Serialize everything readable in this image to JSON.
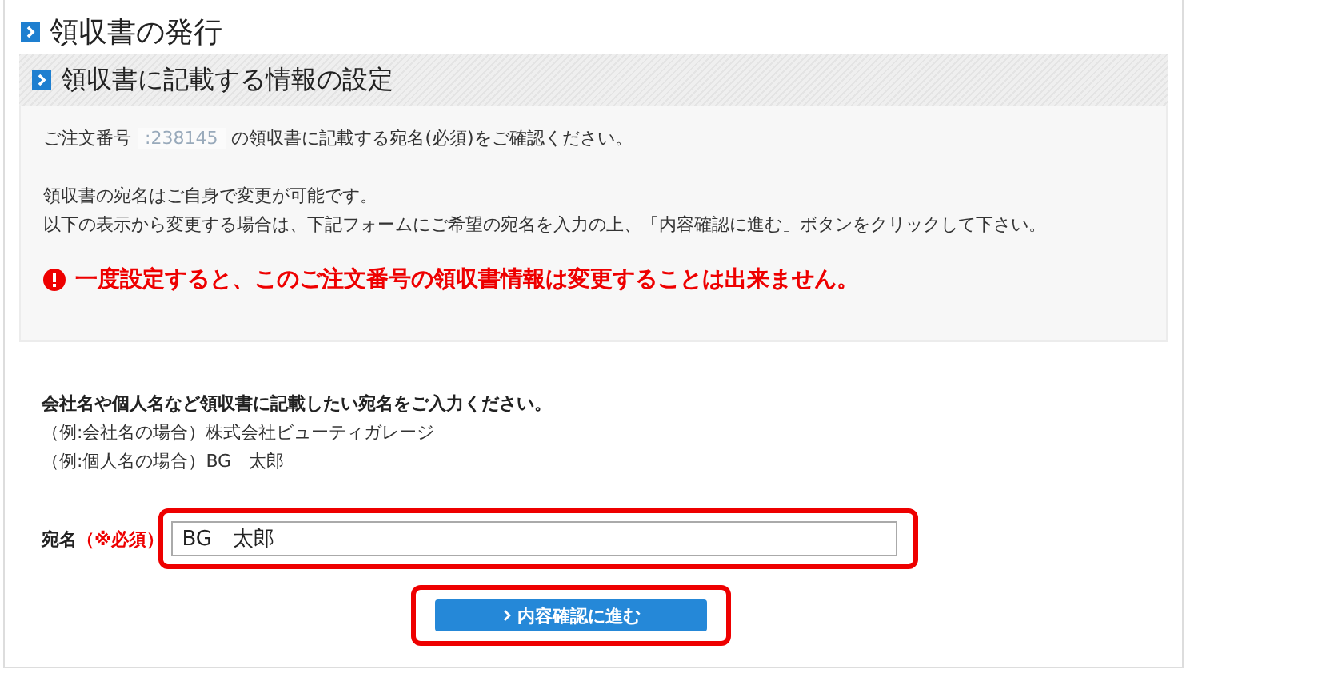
{
  "page_title": "領収書の発行",
  "section": {
    "title": "領収書に記載する情報の設定",
    "order_line": {
      "before": "ご注文番号",
      "order_number": ":238145",
      "after": "の領収書に記載する宛名(必須)をご確認ください。"
    },
    "paragraphs": [
      "領収書の宛名はご自身で変更が可能です。",
      "以下の表示から変更する場合は、下記フォームにご希望の宛名を入力の上、「内容確認に進む」ボタンをクリックして下さい。"
    ],
    "warning": "一度設定すると、このご注文番号の領収書情報は変更することは出来ません。"
  },
  "form": {
    "instruction": "会社名や個人名など領収書に記載したい宛名をご入力ください。",
    "examples": [
      "（例:会社名の場合）株式会社ビューティガレージ",
      "（例:個人名の場合）BG　太郎"
    ],
    "field": {
      "label": "宛名",
      "required_mark": "（※必須）",
      "value": "BG　太郎",
      "highlighted": true
    },
    "submit": {
      "label": "内容確認に進む",
      "highlighted": true
    }
  }
}
